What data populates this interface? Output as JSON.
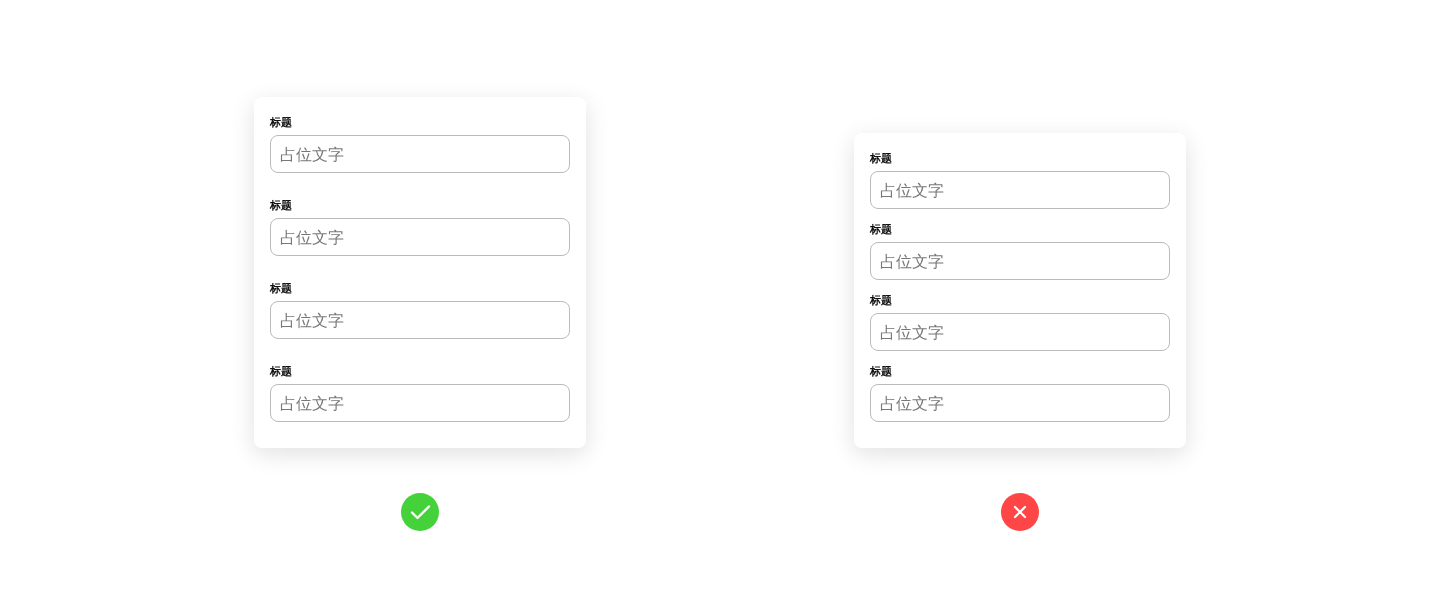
{
  "examples": [
    {
      "correct": true,
      "fields": [
        {
          "label": "标题",
          "placeholder": "占位文字"
        },
        {
          "label": "标题",
          "placeholder": "占位文字"
        },
        {
          "label": "标题",
          "placeholder": "占位文字"
        },
        {
          "label": "标题",
          "placeholder": "占位文字"
        }
      ]
    },
    {
      "correct": false,
      "fields": [
        {
          "label": "标题",
          "placeholder": "占位文字"
        },
        {
          "label": "标题",
          "placeholder": "占位文字"
        },
        {
          "label": "标题",
          "placeholder": "占位文字"
        },
        {
          "label": "标题",
          "placeholder": "占位文字"
        }
      ]
    }
  ]
}
